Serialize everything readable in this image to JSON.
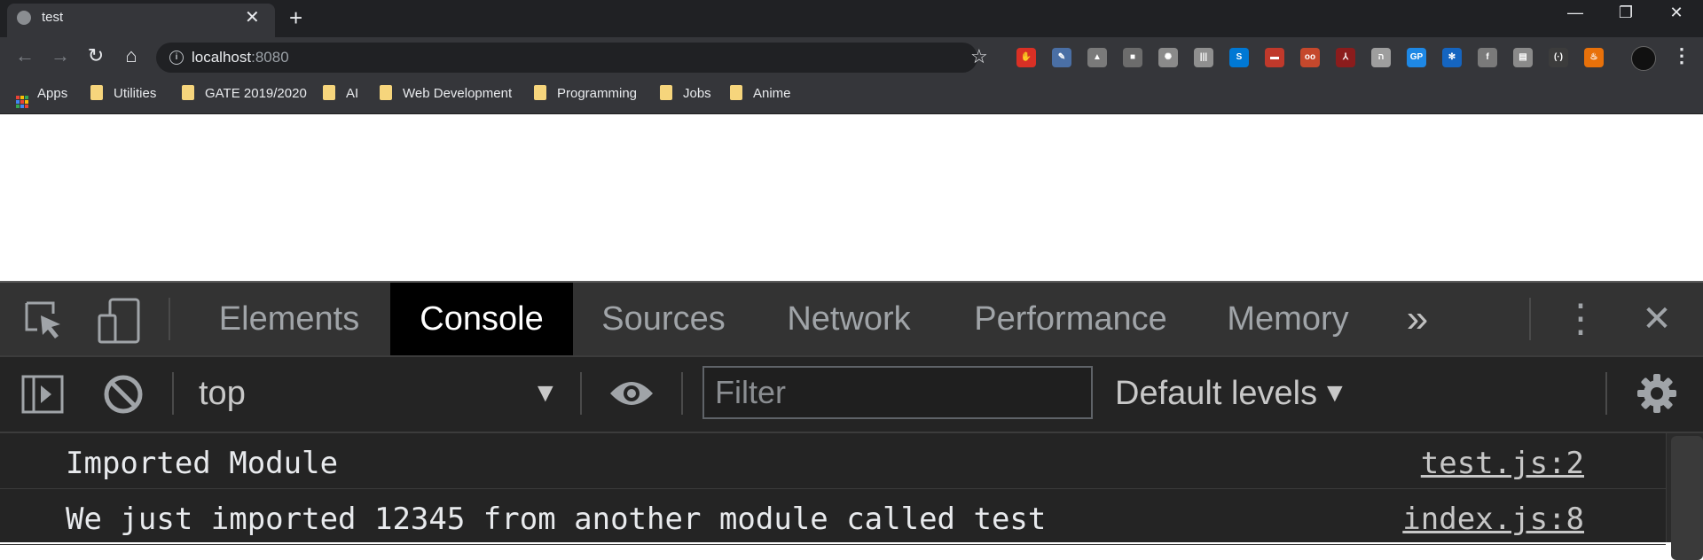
{
  "browser": {
    "tab_title": "test",
    "tab_close": "✕",
    "new_tab": "+",
    "window_controls": {
      "minimize": "—",
      "restore": "❐",
      "close": "✕"
    },
    "nav": {
      "back": "←",
      "forward": "→",
      "reload": "↻",
      "home": "⌂"
    },
    "url_host": "localhost",
    "url_port": ":8080",
    "info_icon": "i",
    "star": "☆",
    "menu": "⋮",
    "extensions": [
      {
        "name": "adblock-icon",
        "glyph": "✋",
        "color": "#d93025"
      },
      {
        "name": "pen-icon",
        "glyph": "✎",
        "color": "#4a6fa5"
      },
      {
        "name": "drive-icon",
        "glyph": "▲",
        "color": "#7a7a7a"
      },
      {
        "name": "tool-icon",
        "glyph": "■",
        "color": "#6c6c6c"
      },
      {
        "name": "globe-icon",
        "glyph": "✺",
        "color": "#8a8a8a"
      },
      {
        "name": "barcode-icon",
        "glyph": "|||",
        "color": "#8f8f8f"
      },
      {
        "name": "skype-icon",
        "glyph": "S",
        "color": "#0078d4"
      },
      {
        "name": "ninja-icon",
        "glyph": "▬",
        "color": "#c0392b"
      },
      {
        "name": "eyes-icon",
        "glyph": "oo",
        "color": "#c5482c"
      },
      {
        "name": "pdf-icon",
        "glyph": "⅄",
        "color": "#8b1c1c"
      },
      {
        "name": "hebrew-icon",
        "glyph": "ה",
        "color": "#9e9e9e"
      },
      {
        "name": "gp-icon",
        "glyph": "GP",
        "color": "#1e88e5"
      },
      {
        "name": "react-icon",
        "glyph": "✻",
        "color": "#1565c0"
      },
      {
        "name": "facebook-icon",
        "glyph": "f",
        "color": "#7a7a7a"
      },
      {
        "name": "stack-icon",
        "glyph": "▤",
        "color": "#8a8a8a"
      },
      {
        "name": "braces-icon",
        "glyph": "(·)",
        "color": "#3c3c3c"
      },
      {
        "name": "fire-icon",
        "glyph": "♨",
        "color": "#e8710a"
      }
    ]
  },
  "bookmarks": [
    {
      "label": "Apps",
      "name": "bookmark-apps"
    },
    {
      "label": "Utilities",
      "name": "bookmark-utilities"
    },
    {
      "label": "GATE 2019/2020",
      "name": "bookmark-gate"
    },
    {
      "label": "AI",
      "name": "bookmark-ai"
    },
    {
      "label": "Web Development",
      "name": "bookmark-web-development"
    },
    {
      "label": "Programming",
      "name": "bookmark-programming"
    },
    {
      "label": "Jobs",
      "name": "bookmark-jobs"
    },
    {
      "label": "Anime",
      "name": "bookmark-anime"
    }
  ],
  "devtools": {
    "tabs": [
      "Elements",
      "Console",
      "Sources",
      "Network",
      "Performance",
      "Memory"
    ],
    "active_tab": "Console",
    "more_tabs": "»",
    "kebab": "⋮",
    "close": "✕",
    "context": "top",
    "dropdown_arrow": "▼",
    "filter_placeholder": "Filter",
    "filter_value": "",
    "levels": "Default levels",
    "messages": [
      {
        "text": "Imported Module",
        "source": "test.js:2"
      },
      {
        "text": "We just imported 12345 from another module called test",
        "source": "index.js:8"
      }
    ]
  },
  "colors": {
    "accent_active_tab": "#000000",
    "devtools_bg": "#242424",
    "folder": "#f6d57c"
  }
}
